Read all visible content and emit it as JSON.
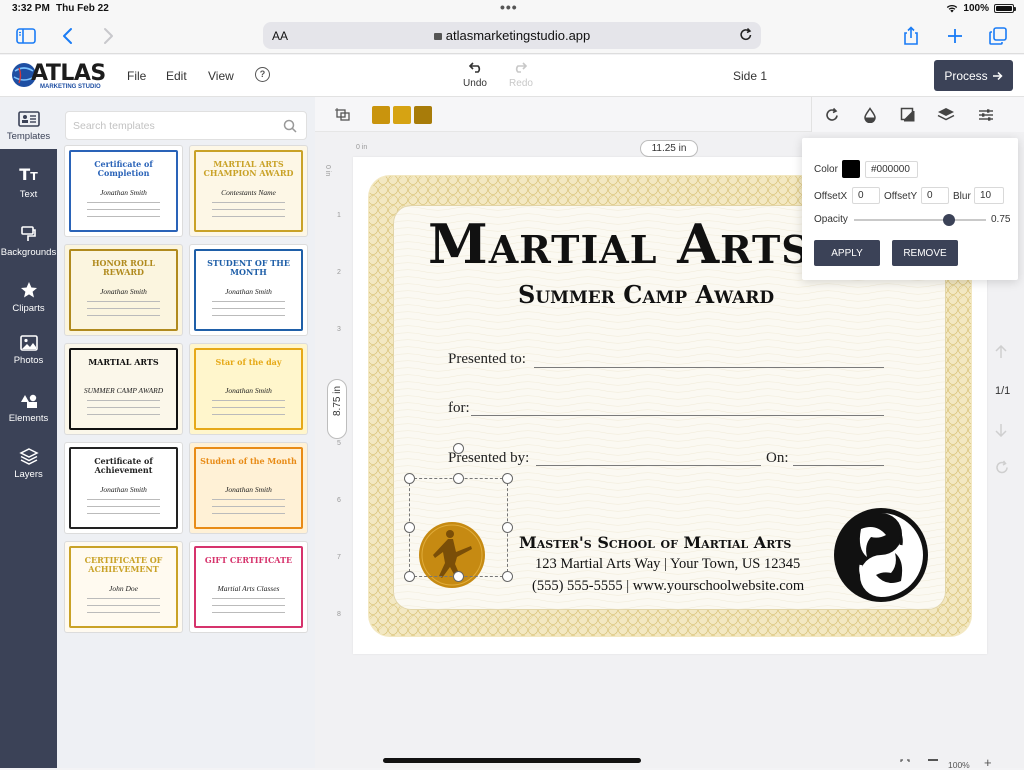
{
  "status_bar": {
    "time": "3:32 PM",
    "date": "Thu Feb 22",
    "battery": "100%"
  },
  "browser": {
    "text_size_label": "AA",
    "url": "atlasmarketingstudio.app"
  },
  "app": {
    "logo_text": "ATLAS",
    "logo_subtext": "MARKETING STUDIO",
    "menu": [
      "File",
      "Edit",
      "View"
    ],
    "undo_label": "Undo",
    "redo_label": "Redo",
    "side_label": "Side 1",
    "process_label": "Process"
  },
  "left_nav": [
    {
      "label": "Templates",
      "icon": "templates-icon"
    },
    {
      "label": "Text",
      "icon": "text-icon"
    },
    {
      "label": "Backgrounds",
      "icon": "backgrounds-icon"
    },
    {
      "label": "Cliparts",
      "icon": "star-icon"
    },
    {
      "label": "Photos",
      "icon": "photo-icon"
    },
    {
      "label": "Elements",
      "icon": "shapes-icon"
    },
    {
      "label": "Layers",
      "icon": "layers-icon"
    }
  ],
  "templates_panel": {
    "search_placeholder": "Search templates",
    "items": [
      {
        "title": "Certificate of Completion",
        "name": "Jonathan Smith",
        "accent": "#2a63b8",
        "bg": "#ffffff"
      },
      {
        "title": "MARTIAL ARTS CHAMPION AWARD",
        "name": "Contestants Name",
        "accent": "#c9a227",
        "bg": "#fdf7e6"
      },
      {
        "title": "HONOR ROLL REWARD",
        "name": "Jonathan Smith",
        "accent": "#b08a1e",
        "bg": "#fbf5df"
      },
      {
        "title": "STUDENT OF THE MONTH",
        "name": "Jonathan Smith",
        "accent": "#1f5fa8",
        "bg": "#ffffff"
      },
      {
        "title": "MARTIAL ARTS",
        "name": "SUMMER CAMP AWARD",
        "accent": "#111111",
        "bg": "#fbf7ea"
      },
      {
        "title": "Star of the day",
        "name": "Jonathan Smith",
        "accent": "#e6a917",
        "bg": "#fff6cc"
      },
      {
        "title": "Certificate of Achievement",
        "name": "Jonathan Smith",
        "accent": "#222222",
        "bg": "#ffffff"
      },
      {
        "title": "Student of the Month",
        "name": "Jonathan Smith",
        "accent": "#e88b16",
        "bg": "#fff1d6"
      },
      {
        "title": "CERTIFICATE OF ACHIEVEMENT",
        "name": "John Doe",
        "accent": "#c9a227",
        "bg": "#fffaf0"
      },
      {
        "title": "GIFT CERTIFICATE",
        "name": "Martial Arts Classes",
        "accent": "#d6336c",
        "bg": "#ffffff"
      }
    ]
  },
  "toolbar": {
    "swatches": [
      "#c9940d",
      "#d6a313",
      "#a87c0a"
    ]
  },
  "canvas": {
    "width_label": "11.25 in",
    "height_label": "8.75 in",
    "ruler_h_zero": "0 in",
    "ruler_v_zero": "0 in",
    "ruler_v_marks": [
      "1",
      "2",
      "3",
      "4",
      "5",
      "6",
      "7",
      "8"
    ],
    "page_indicator": "1/1",
    "zoom": "100%"
  },
  "certificate": {
    "title": "Martial Arts",
    "subtitle": "Summer Camp Award",
    "presented_to": "Presented to:",
    "for": "for:",
    "presented_by": "Presented by:",
    "on": "On:",
    "school_name": "Master's School of Martial Arts",
    "address": "123 Martial Arts Way | Your Town, US 12345",
    "contact": "(555) 555-5555 | www.yourschoolwebsite.com",
    "seal_color": "#c68a12"
  },
  "shadow_panel": {
    "color_label": "Color",
    "color_value": "#000000",
    "offset_x_label": "OffsetX",
    "offset_x": "0",
    "offset_y_label": "OffsetY",
    "offset_y": "0",
    "blur_label": "Blur",
    "blur": "10",
    "opacity_label": "Opacity",
    "opacity": "0.75",
    "apply_label": "APPLY",
    "remove_label": "REMOVE"
  }
}
